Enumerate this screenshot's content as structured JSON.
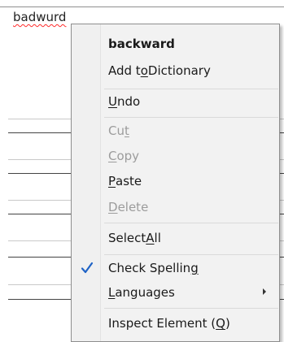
{
  "field": {
    "text": "badwurd"
  },
  "menu": {
    "suggestion": "backward",
    "add_to_dictionary": {
      "pre": "Add t",
      "key": "o",
      "post": " Dictionary"
    },
    "undo": {
      "pre": "",
      "key": "U",
      "post": "ndo"
    },
    "cut": {
      "pre": "Cu",
      "key": "t",
      "post": ""
    },
    "copy": {
      "pre": "",
      "key": "C",
      "post": "opy"
    },
    "paste": {
      "pre": "",
      "key": "P",
      "post": "aste"
    },
    "delete": {
      "pre": "",
      "key": "D",
      "post": "elete"
    },
    "select_all": {
      "pre": "Select ",
      "key": "A",
      "post": "ll"
    },
    "check_spelling": {
      "pre": "Check Spellin",
      "key": "g",
      "post": ""
    },
    "languages": {
      "pre": "",
      "key": "L",
      "post": "anguages"
    },
    "inspect": {
      "pre": "Inspect Element (",
      "key": "Q",
      "post": ")"
    }
  },
  "colors": {
    "check_icon": "#1f63c6",
    "spell_underline": "#ff2a2a"
  }
}
